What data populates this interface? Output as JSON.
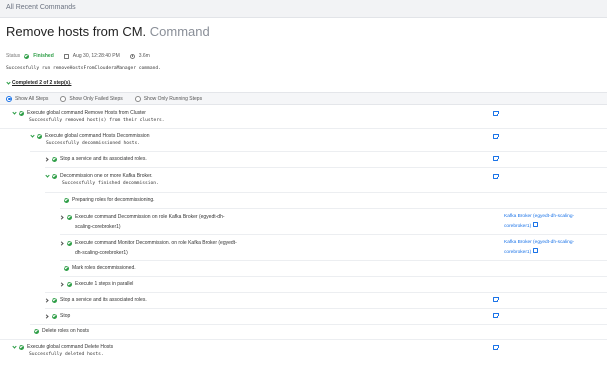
{
  "breadcrumb": "All Recent Commands",
  "title": {
    "main": "Remove hosts from CM.",
    "suffix": "Command"
  },
  "status": {
    "label": "Status",
    "value": "Finished",
    "date": "Aug 30, 12:28:40 PM",
    "duration": "3.6m"
  },
  "summary": "Successfully run removeHostsFromClouderaManager command.",
  "completed_label": "Completed 2 of 2 step(s).",
  "filters": [
    "Show All Steps",
    "Show Only Failed Steps",
    "Show Only Running Steps"
  ],
  "colors": {
    "success": "#2e9e47",
    "link": "#1a73e8"
  },
  "steps": [
    {
      "label": "Execute global command Remove Hosts from Cluster",
      "detail": "Successfully removed host(s) from their clusters."
    },
    {
      "label": "Execute global command Hosts Decommission",
      "detail": "Successfully decommissioned hosts."
    },
    {
      "label": "Stop a service and its associated roles."
    },
    {
      "label": "Decommission one or more Kafka Broker.",
      "detail": "Successfully finished decommission."
    },
    {
      "label": "Preparing roles for decommissioning."
    },
    {
      "label_l1": "Execute command Decommission on role Kafka Broker (egyedt-dh-",
      "label_l2": "scaling-corebroker1)",
      "role_l1": "Kafka Broker (egyedt-dh-scaling-",
      "role_l2": "corebroker1)"
    },
    {
      "label_l1": "Execute command Monitor Decommission. on role Kafka Broker (egyedt-",
      "label_l2": "dh-scaling-corebroker1)",
      "role_l1": "Kafka Broker (egyedt-dh-scaling-",
      "role_l2": "corebroker1)"
    },
    {
      "label": "Mark roles decommissioned."
    },
    {
      "label": "Execute 1 steps in parallel"
    },
    {
      "label": "Stop a service and its associated roles."
    },
    {
      "label": "Stop"
    },
    {
      "label": "Delete roles on hosts"
    },
    {
      "label": "Execute global command Delete Hosts",
      "detail": "Successfully deleted hosts."
    }
  ]
}
